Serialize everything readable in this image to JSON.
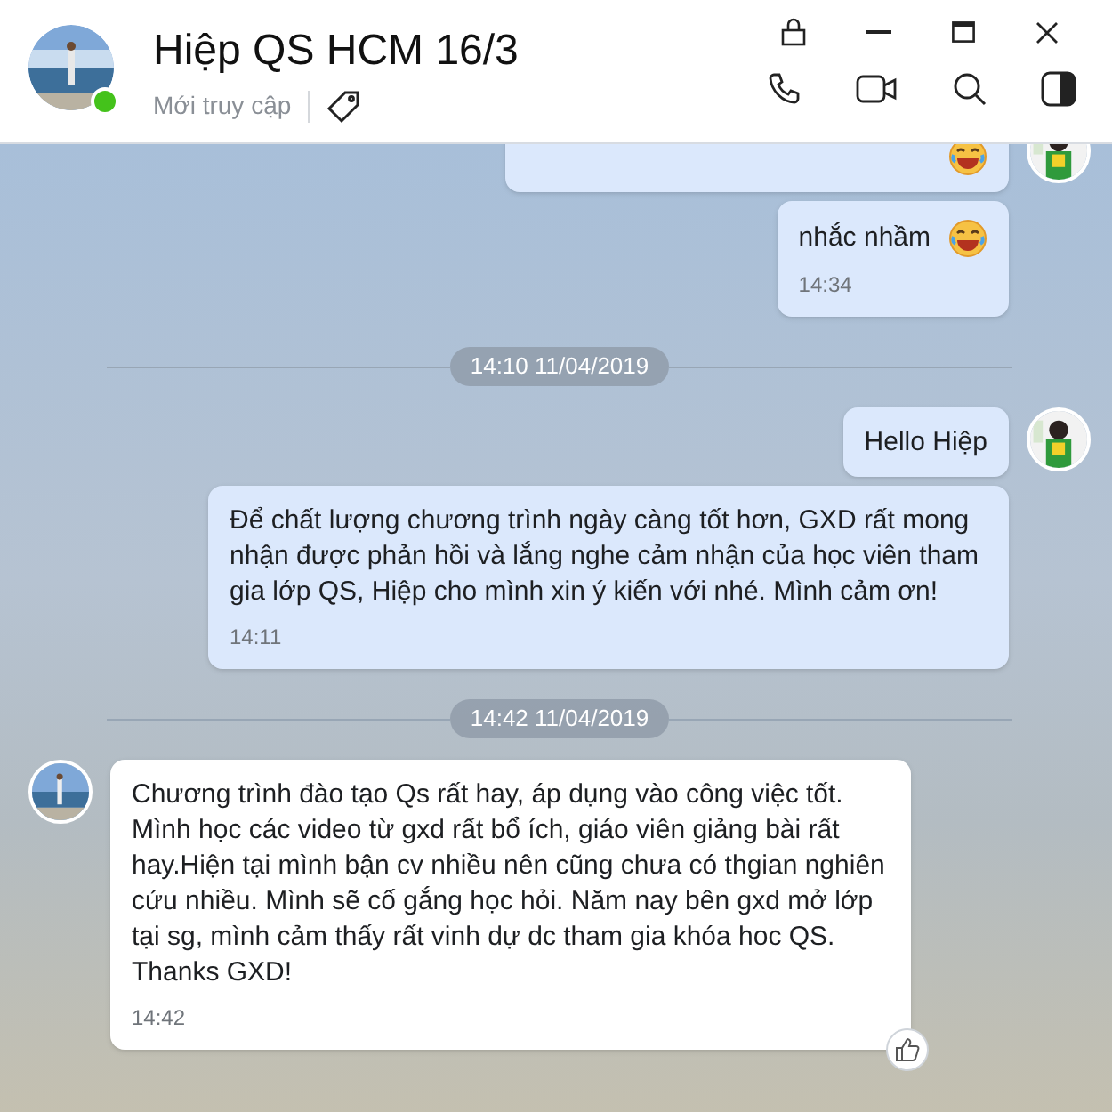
{
  "header": {
    "name": "Hiệp QS HCM 16/3",
    "status": "Mới truy cập",
    "online": true
  },
  "messages": [
    {
      "kind": "message",
      "outgoing": true,
      "emoji": true,
      "avatar": true
    },
    {
      "kind": "message",
      "outgoing": true,
      "text": "nhắc nhầm",
      "emoji": true,
      "time": "14:34"
    },
    {
      "kind": "divider",
      "text": "14:10 11/04/2019"
    },
    {
      "kind": "message",
      "outgoing": true,
      "text": "Hello Hiệp",
      "avatar": true
    },
    {
      "kind": "message",
      "outgoing": true,
      "text": "Để chất lượng chương trình ngày càng tốt hơn, GXD rất mong nhận được phản hồi và lắng nghe cảm nhận của học viên tham gia lớp QS, Hiệp cho mình xin ý kiến với nhé. Mình cảm ơn!",
      "time": "14:11"
    },
    {
      "kind": "divider",
      "text": "14:42 11/04/2019"
    },
    {
      "kind": "message",
      "outgoing": false,
      "text": "Chương trình đào tạo Qs rất hay, áp dụng vào công việc tốt. Mình học các video từ gxd rất bổ ích, giáo viên giảng bài rất hay.Hiện tại mình bận cv nhiều nên cũng chưa có thgian nghiên cứu nhiều. Mình sẽ cố gắng học hỏi. Năm nay bên gxd mở lớp tại sg, mình cảm thấy rất vinh dự dc tham gia khóa hoc QS. Thanks GXD!",
      "time": "14:42",
      "avatar": true,
      "like": true
    }
  ]
}
